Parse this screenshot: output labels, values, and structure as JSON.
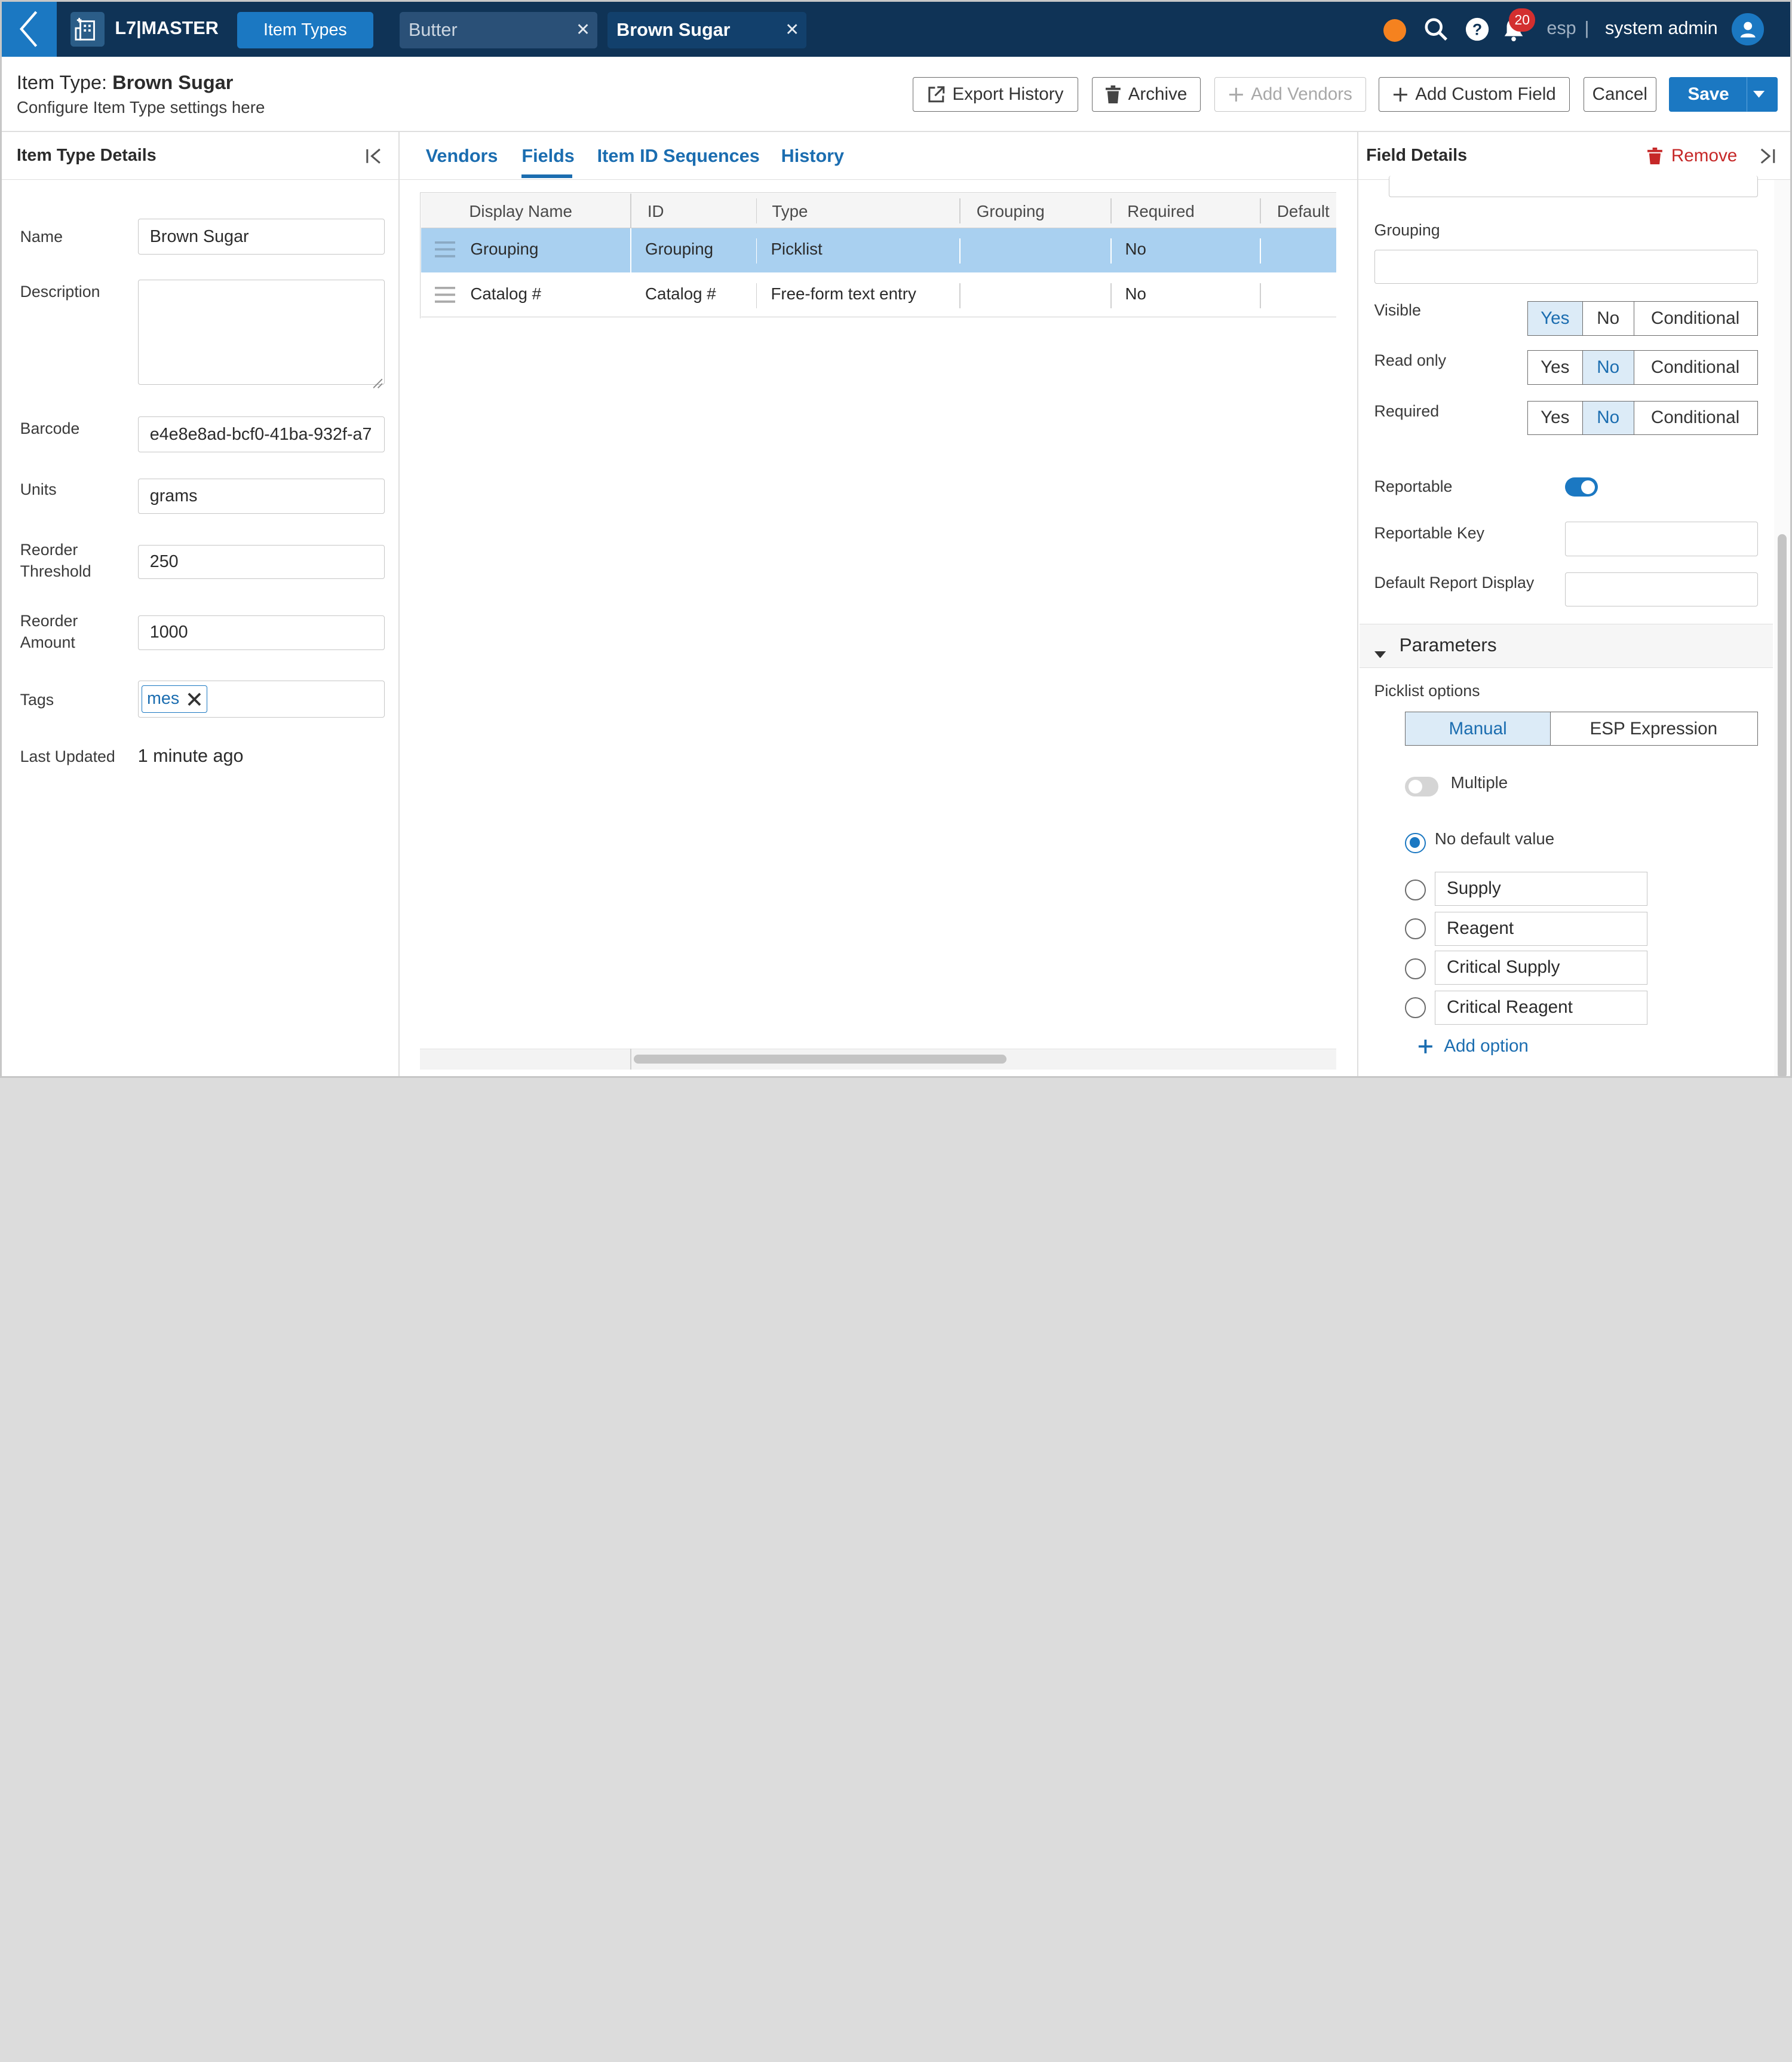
{
  "app": {
    "brand": "L7|MASTER",
    "nav_tab": "Item Types"
  },
  "doc_tabs": [
    {
      "label": "Butter"
    },
    {
      "label": "Brown Sugar"
    }
  ],
  "header_right": {
    "notification_count": "20",
    "workspace": "esp",
    "separator": "|",
    "user": "system admin"
  },
  "page": {
    "title_prefix": "Item Type:",
    "title_name": "Brown Sugar",
    "subtitle": "Configure Item Type settings here"
  },
  "toolbar": {
    "export_history": "Export History",
    "archive": "Archive",
    "add_vendors": "Add Vendors",
    "add_custom_field": "Add Custom Field",
    "cancel": "Cancel",
    "save": "Save"
  },
  "left_panel": {
    "title": "Item Type Details",
    "name_label": "Name",
    "name_value": "Brown Sugar",
    "description_label": "Description",
    "description_value": "",
    "barcode_label": "Barcode",
    "barcode_value": "e4e8e8ad-bcf0-41ba-932f-a7",
    "units_label": "Units",
    "units_value": "grams",
    "reorder_threshold_label": "Reorder Threshold",
    "reorder_threshold_value": "250",
    "reorder_amount_label": "Reorder Amount",
    "reorder_amount_value": "1000",
    "tags_label": "Tags",
    "tag": "mes",
    "last_updated_label": "Last Updated",
    "last_updated_value": "1 minute ago"
  },
  "main_tabs": [
    {
      "label": "Vendors"
    },
    {
      "label": "Fields",
      "active": true
    },
    {
      "label": "Item ID Sequences"
    },
    {
      "label": "History"
    }
  ],
  "table": {
    "columns": [
      "Display Name",
      "ID",
      "Type",
      "Grouping",
      "Required",
      "Default"
    ],
    "rows": [
      {
        "display_name": "Grouping",
        "id": "Grouping",
        "type": "Picklist",
        "grouping": "",
        "required": "No",
        "default": "",
        "selected": true
      },
      {
        "display_name": "Catalog #",
        "id": "Catalog #",
        "type": "Free-form text entry",
        "grouping": "",
        "required": "No",
        "default": ""
      }
    ]
  },
  "right_panel": {
    "title": "Field Details",
    "remove": "Remove",
    "grouping_label": "Grouping",
    "grouping_value": "",
    "visible_label": "Visible",
    "read_only_label": "Read only",
    "required_label": "Required",
    "seg_yes": "Yes",
    "seg_no": "No",
    "seg_conditional": "Conditional",
    "visible_selected": "Yes",
    "read_only_selected": "No",
    "required_selected": "No",
    "reportable_label": "Reportable",
    "reportable_on": true,
    "reportable_key_label": "Reportable Key",
    "reportable_key_value": "",
    "default_report_display_label": "Default Report Display",
    "default_report_display_value": "",
    "parameters_label": "Parameters",
    "picklist_options_label": "Picklist options",
    "manual": "Manual",
    "esp_expression": "ESP Expression",
    "multiple_label": "Multiple",
    "multiple_on": false,
    "no_default_label": "No default value",
    "options": [
      "Supply",
      "Reagent",
      "Critical Supply",
      "Critical Reagent"
    ],
    "add_option": "Add option"
  },
  "colors": {
    "topbar": "#0f3356",
    "accent": "#1b78c2",
    "link": "#1b6db0",
    "selected_row": "#a9d0f0",
    "danger": "#c62828",
    "status_dot": "#f5821f",
    "badge": "#d32f2f"
  }
}
